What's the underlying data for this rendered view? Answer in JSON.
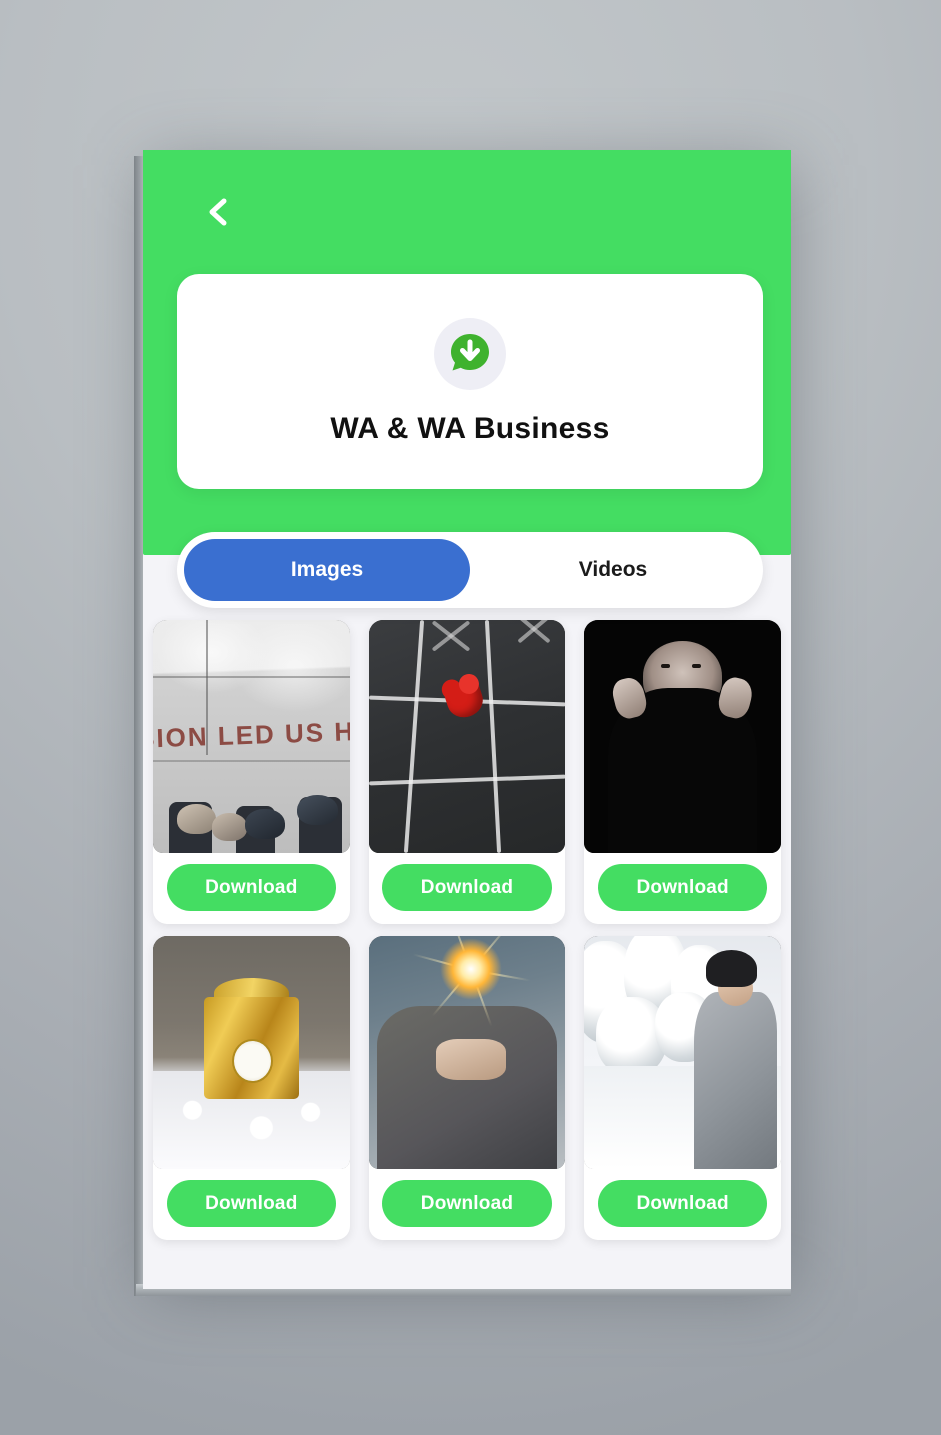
{
  "app": {
    "header": {
      "back_icon": "chevron-left-icon",
      "brand_icon": "whatsapp-download-bubble-icon",
      "title": "WA & WA Business"
    },
    "colors": {
      "brand_green": "#44dd62",
      "tab_active_blue": "#3a6fd0",
      "card_white": "#ffffff",
      "content_background": "#f4f4f8",
      "logo_circle": "#eeeef5",
      "page_background": "#b2b7bc"
    }
  },
  "tabs": [
    {
      "label": "Images",
      "active": true
    },
    {
      "label": "Videos",
      "active": false
    }
  ],
  "gallery": {
    "download_label": "Download",
    "items": [
      {
        "id": "item-1",
        "art": "art-shoes",
        "caption_overlay": "SION LED US H",
        "alt": "couple shoes on pavement"
      },
      {
        "id": "item-2",
        "art": "art-chalk",
        "caption_overlay": "",
        "alt": "chalk tic tac toe with red heart"
      },
      {
        "id": "item-3",
        "art": "art-dark",
        "caption_overlay": "",
        "alt": "woman covering face in black"
      },
      {
        "id": "item-4",
        "art": "art-clock",
        "caption_overlay": "",
        "alt": "golden clock ornament in snow"
      },
      {
        "id": "item-5",
        "art": "art-spark",
        "caption_overlay": "",
        "alt": "hands holding a sparkler"
      },
      {
        "id": "item-6",
        "art": "art-snow",
        "caption_overlay": "",
        "alt": "woman in grey coat in snowy forest"
      }
    ]
  }
}
